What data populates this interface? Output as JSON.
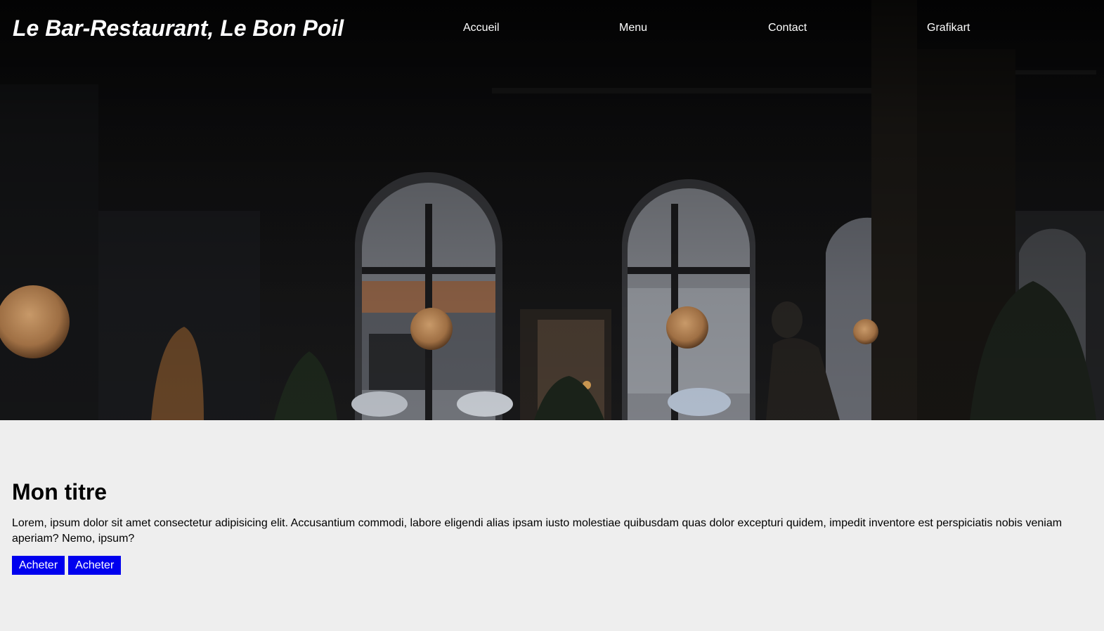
{
  "header": {
    "site_title": "Le Bar-Restaurant, Le Bon Poil",
    "nav": [
      {
        "label": "Accueil"
      },
      {
        "label": "Menu"
      },
      {
        "label": "Contact"
      },
      {
        "label": "Grafikart"
      }
    ]
  },
  "main": {
    "title": "Mon titre",
    "text": "Lorem, ipsum dolor sit amet consectetur adipisicing elit. Accusantium commodi, labore eligendi alias ipsam iusto molestiae quibusdam quas dolor excepturi quidem, impedit inventore est perspiciatis nobis veniam aperiam? Nemo, ipsum?",
    "buttons": [
      {
        "label": "Acheter"
      },
      {
        "label": "Acheter"
      }
    ]
  },
  "colors": {
    "button_bg": "#0000ee",
    "content_bg": "#eeeeee"
  }
}
